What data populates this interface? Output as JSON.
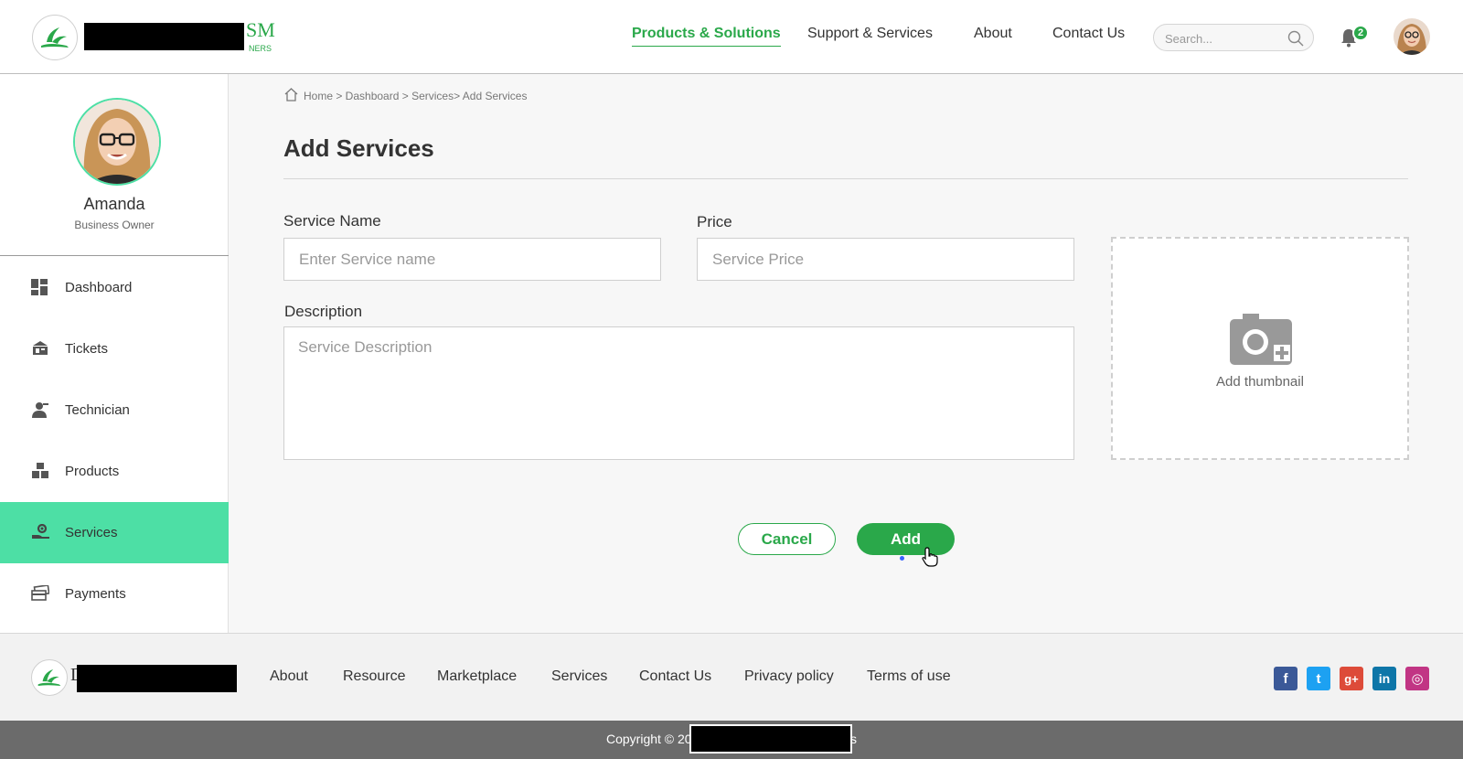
{
  "brand": {
    "logo_text": "SM",
    "logo_suffix": "NERS",
    "accent": "#2aa84a",
    "highlight": "#4ddfa5"
  },
  "header": {
    "nav": [
      "Products & Solutions",
      "Support & Services",
      "About",
      "Contact Us"
    ],
    "search_placeholder": "Search...",
    "notification_count": "2"
  },
  "sidebar": {
    "user_name": "Amanda",
    "user_role": "Business Owner",
    "items": [
      {
        "label": "Dashboard",
        "icon": "dashboard-icon"
      },
      {
        "label": "Tickets",
        "icon": "tickets-icon"
      },
      {
        "label": "Technician",
        "icon": "technician-icon"
      },
      {
        "label": "Products",
        "icon": "products-icon"
      },
      {
        "label": "Services",
        "icon": "services-icon",
        "active": true
      },
      {
        "label": "Payments",
        "icon": "payments-icon"
      }
    ]
  },
  "breadcrumb": "Home > Dashboard > Services> Add Services",
  "page": {
    "title": "Add Services",
    "service_name_label": "Service Name",
    "service_name_placeholder": "Enter Service name",
    "price_label": "Price",
    "price_placeholder": "Service Price",
    "description_label": "Description",
    "description_placeholder": "Service Description",
    "thumbnail_label": "Add thumbnail",
    "cancel_label": "Cancel",
    "add_label": "Add"
  },
  "footer": {
    "logo_letter": "D",
    "links": [
      "About",
      "Resource",
      "Marketplace",
      "Services",
      "Contact Us",
      "Privacy policy",
      "Terms of use"
    ],
    "social": [
      {
        "name": "facebook-icon",
        "glyph": "f",
        "color": "#3b5998"
      },
      {
        "name": "twitter-icon",
        "glyph": "t",
        "color": "#1da1f2"
      },
      {
        "name": "google-plus-icon",
        "glyph": "g+",
        "color": "#dd4b39"
      },
      {
        "name": "linkedin-icon",
        "glyph": "in",
        "color": "#0e76a8"
      },
      {
        "name": "instagram-icon",
        "glyph": "◎",
        "color": "#c13584"
      }
    ],
    "copyright_prefix": "Copyright © 20",
    "copyright_suffix": "s"
  }
}
